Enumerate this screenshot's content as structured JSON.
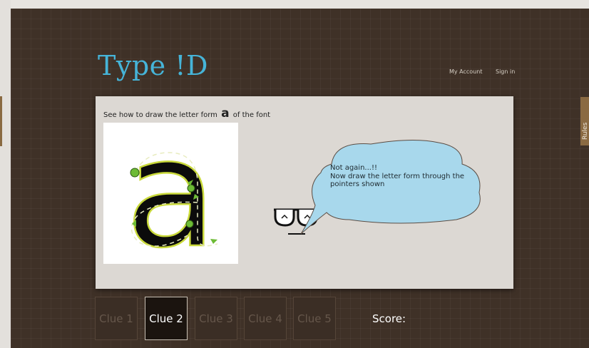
{
  "app": {
    "logo_text": "Type ",
    "logo_id": "!D"
  },
  "nav": {
    "account": "My Account",
    "signin": "Sign in"
  },
  "rules_tab": {
    "label": "Rules"
  },
  "panel": {
    "instruction_before": "See how to draw the letter form",
    "instruction_letter": "a",
    "instruction_after": "of the font"
  },
  "letter": {
    "glyph": "a"
  },
  "bubble": {
    "line1": "Not again...!!",
    "line2": "Now draw the letter form through the",
    "line3": "pointers shown"
  },
  "clues": [
    {
      "label": "Clue 1",
      "active": false
    },
    {
      "label": "Clue 2",
      "active": true
    },
    {
      "label": "Clue 3",
      "active": false
    },
    {
      "label": "Clue 4",
      "active": false
    },
    {
      "label": "Clue 5",
      "active": false
    }
  ],
  "score": {
    "label": "Score:"
  },
  "colors": {
    "brand": "#46b4d8",
    "background": "#3f3127",
    "bubble": "#a8d8ec",
    "rules_tab": "#8a6a42"
  },
  "icons": {
    "mascot": "glasses-face-icon",
    "pointer": "green-dot-pointer-icon",
    "arrow": "direction-arrow-icon"
  }
}
